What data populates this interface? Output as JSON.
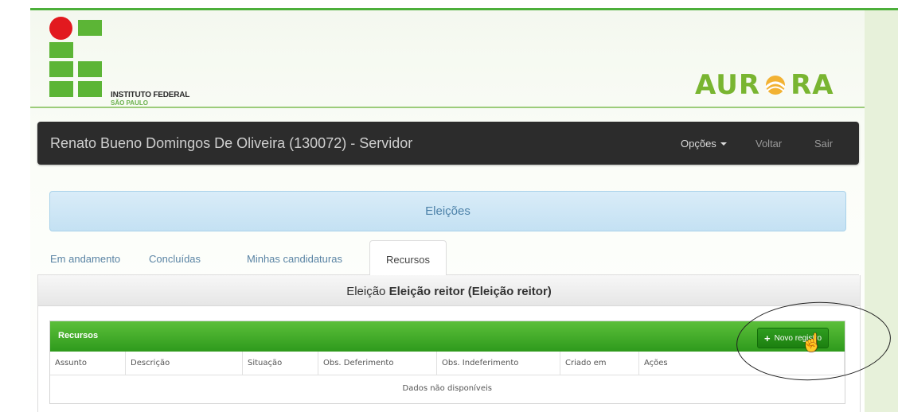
{
  "header": {
    "logo_line1": "INSTITUTO FEDERAL",
    "logo_line2": "SÃO PAULO",
    "brand_left": "AUR",
    "brand_right": "RA"
  },
  "navbar": {
    "user": "Renato Bueno Domingos De Oliveira (130072) - Servidor",
    "opcoes": "Opções",
    "voltar": "Voltar",
    "sair": "Sair"
  },
  "banner": {
    "title": "Eleições"
  },
  "tabs": [
    {
      "label": "Em andamento"
    },
    {
      "label": "Concluídas"
    },
    {
      "label": "Minhas candidaturas"
    },
    {
      "label": "Recursos"
    }
  ],
  "panel": {
    "prefix": "Eleição",
    "election": "Eleição reitor (Eleição reitor)"
  },
  "recursos": {
    "title": "Recursos",
    "new_button": "Novo registro",
    "columns": [
      "Assunto",
      "Descrição",
      "Situação",
      "Obs. Deferimento",
      "Obs. Indeferimento",
      "Criado em",
      "Ações"
    ],
    "empty": "Dados não disponíveis"
  },
  "colors": {
    "navbar": "#2c2c2c",
    "green_bar": "#3aa526",
    "banner": "#cfe6f5",
    "logo_green": "#5cb536",
    "logo_red": "#e2191f"
  }
}
